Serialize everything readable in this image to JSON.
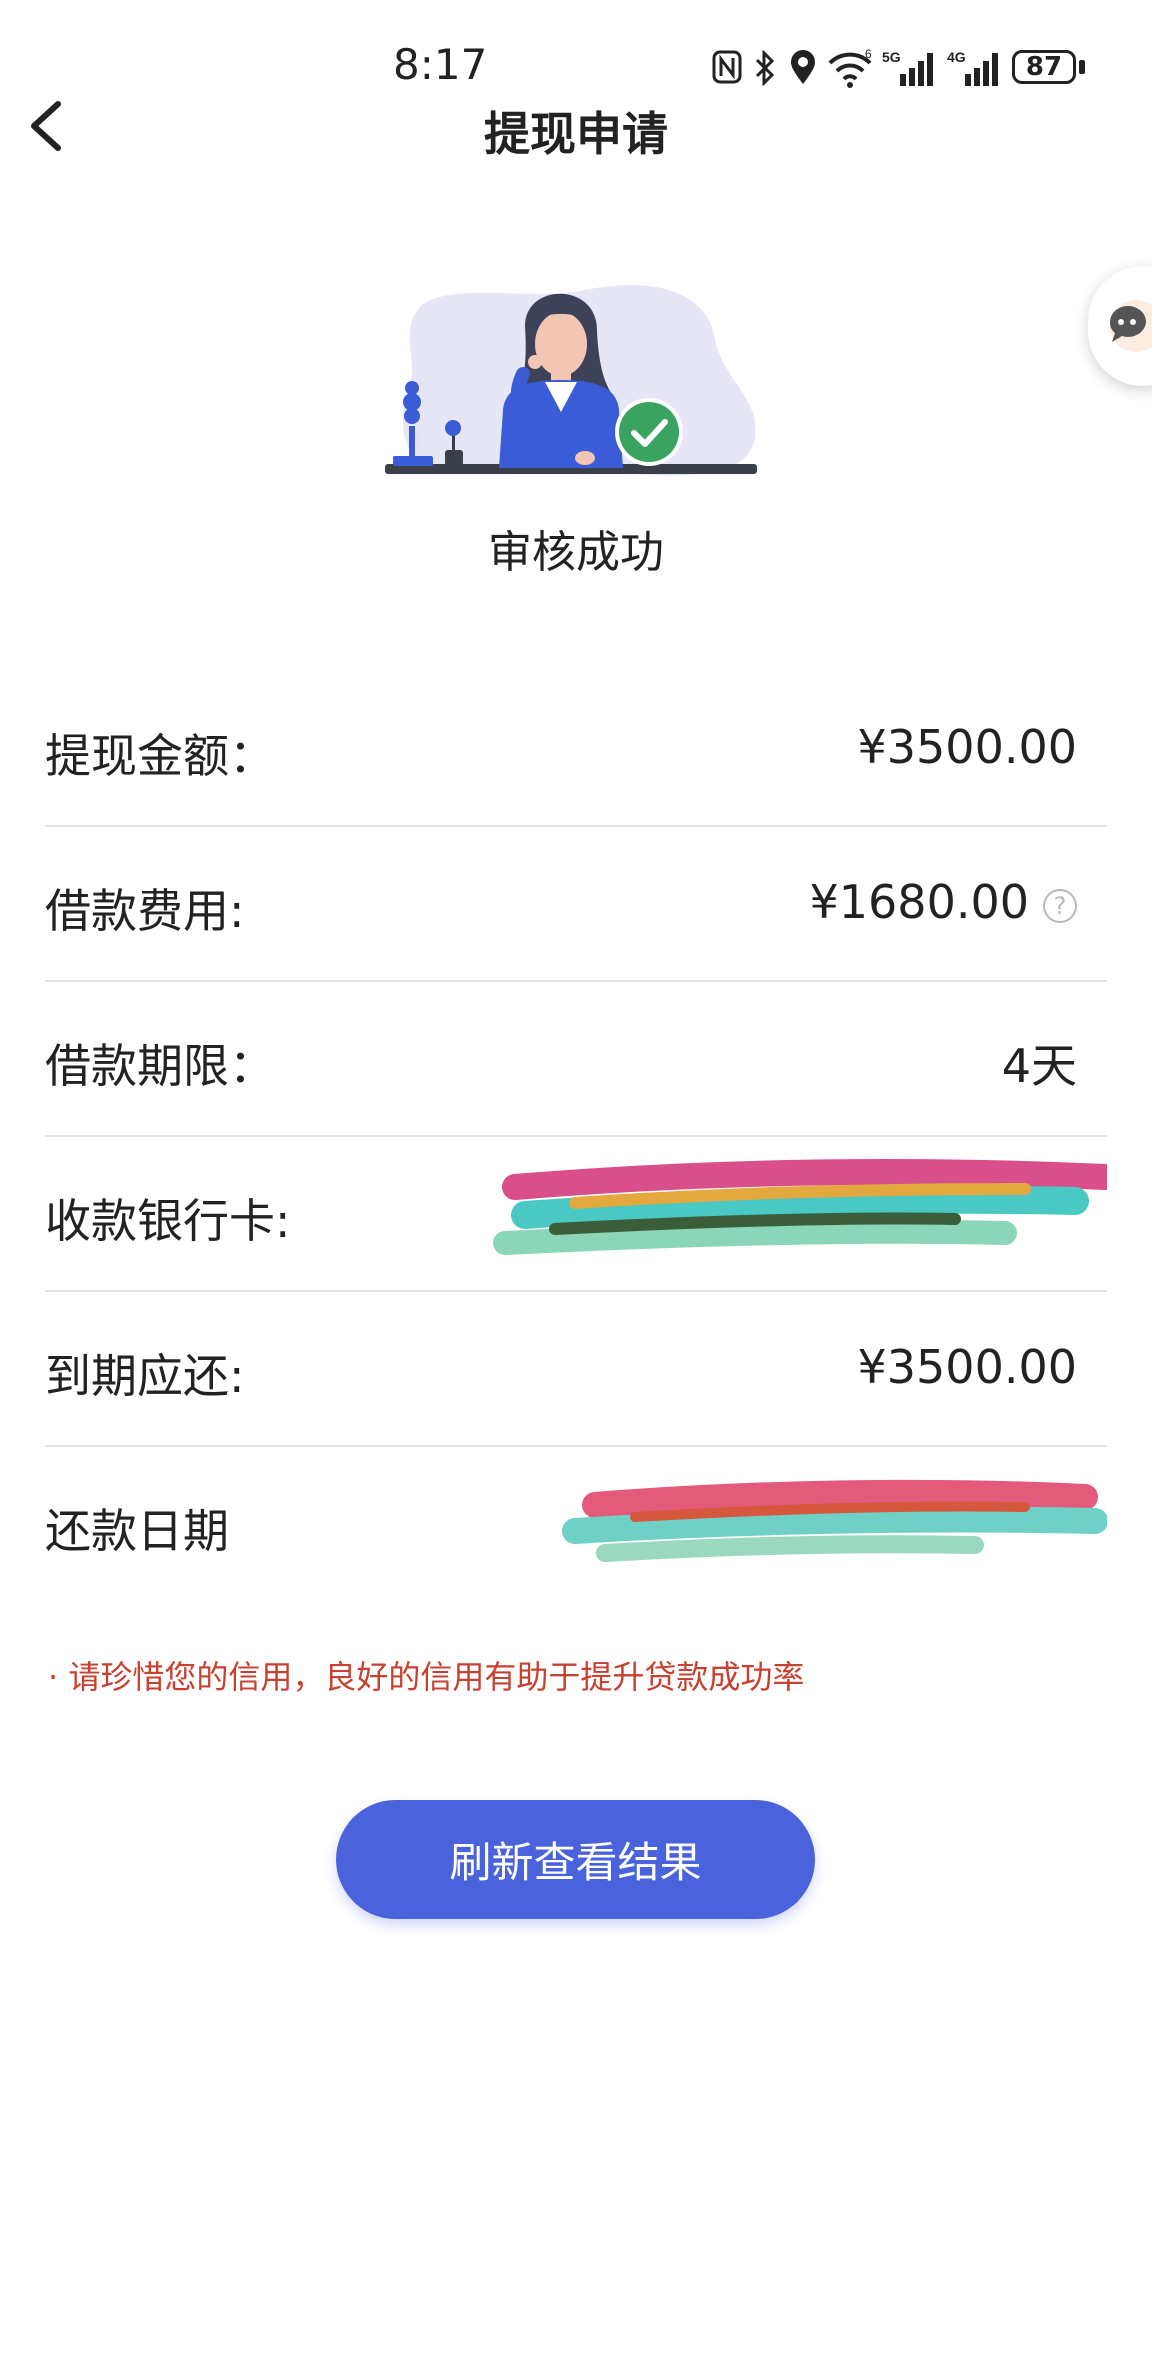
{
  "status_bar": {
    "time": "8:17",
    "battery": "87",
    "icons": [
      "nfc-icon",
      "bluetooth-icon",
      "location-icon",
      "wifi-icon",
      "signal-5g-icon",
      "signal-4g-icon",
      "battery-icon"
    ],
    "network_labels": {
      "wifi": "6",
      "sim1": "5G",
      "sim2": "4G"
    }
  },
  "header": {
    "title": "提现申请",
    "back_icon": "chevron-left-icon"
  },
  "status": {
    "title": "审核成功",
    "icon": "check-circle-icon",
    "accent_color": "#3aa35f"
  },
  "details": [
    {
      "label": "提现金额：",
      "value": "¥3500.00"
    },
    {
      "label": "借款费用:",
      "value": "¥1680.00",
      "help_icon": "question-circle-icon"
    },
    {
      "label": "借款期限：",
      "value": "4天"
    },
    {
      "label": "收款银行卡:",
      "value": ""
    },
    {
      "label": "到期应还:",
      "value": "¥3500.00"
    },
    {
      "label": "还款日期",
      "value": ""
    }
  ],
  "notice": "· 请珍惜您的信用，良好的信用有助于提升贷款成功率",
  "primary_button": {
    "label": "刷新查看结果",
    "color": "#4a63dc"
  },
  "colors": {
    "notice_text": "#c8402f",
    "divider": "#e3e3e3"
  }
}
